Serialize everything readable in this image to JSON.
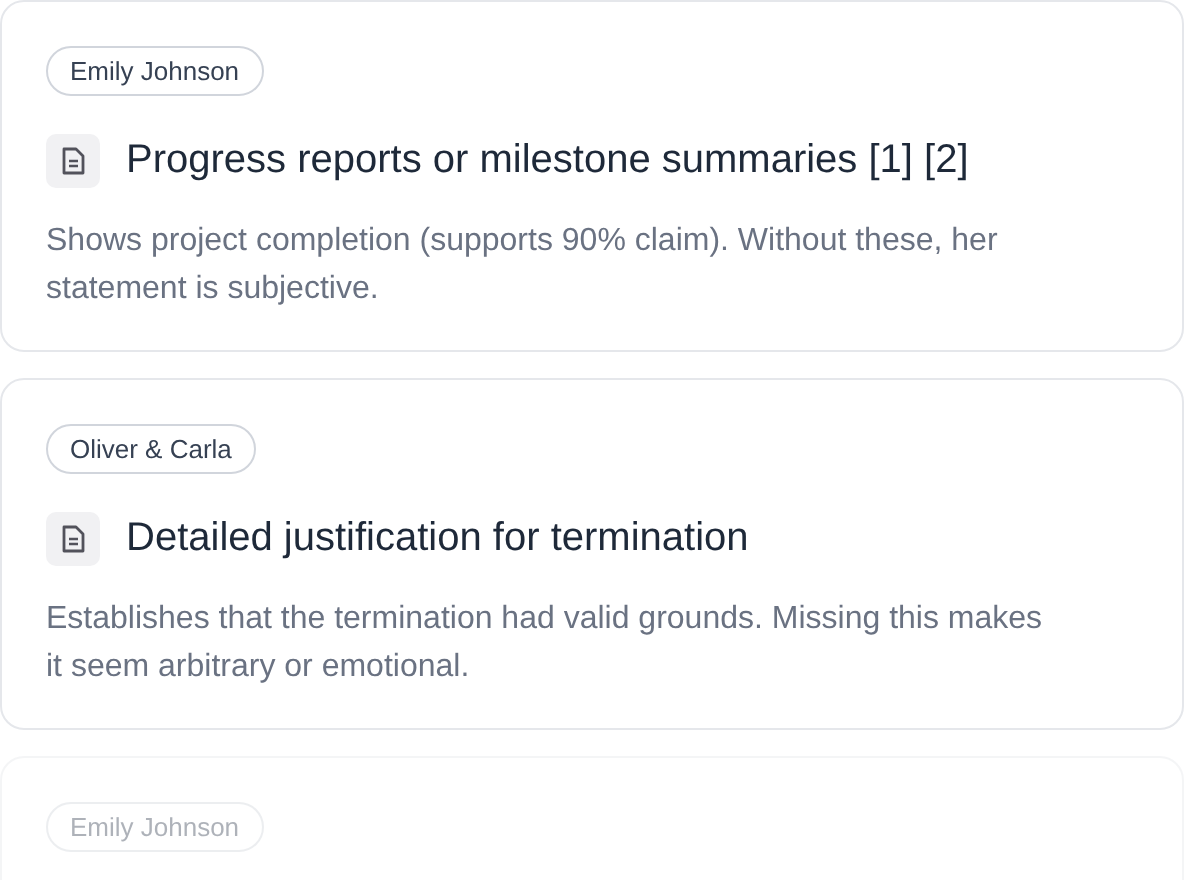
{
  "cards": [
    {
      "author": "Emily Johnson",
      "title": "Progress reports or milestone summaries [1] [2]",
      "description": "Shows project completion (supports 90% claim). Without these, her statement is subjective.",
      "faded": false
    },
    {
      "author": "Oliver & Carla",
      "title": "Detailed justification for termination",
      "description": "Establishes that the termination had valid grounds. Missing this makes it seem arbitrary or emotional.",
      "faded": false
    },
    {
      "author": "Emily Johnson",
      "faded": true
    }
  ]
}
